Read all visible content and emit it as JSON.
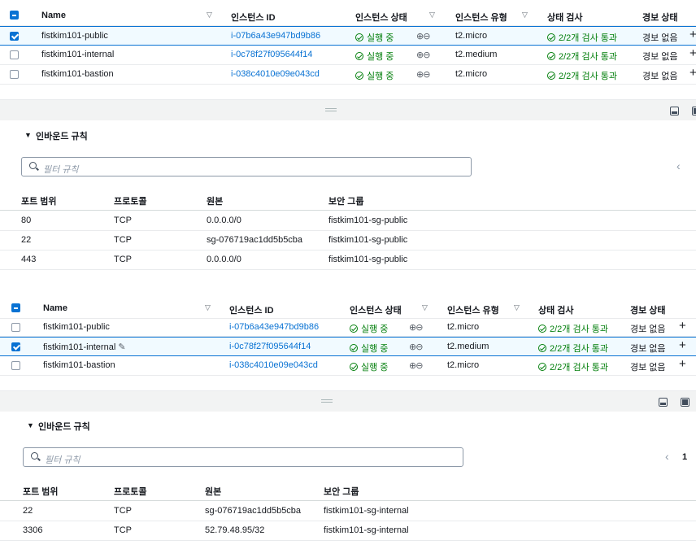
{
  "panel1": {
    "instances": {
      "headers": {
        "name": "Name",
        "id": "인스턴스 ID",
        "state": "인스턴스 상태",
        "type": "인스턴스 유형",
        "check": "상태 검사",
        "alarm": "경보 상태"
      },
      "rows": [
        {
          "name": "fistkim101-public",
          "id": "i-07b6a43e947bd9b86",
          "state": "실행 중",
          "type": "t2.micro",
          "check": "2/2개 검사 통과",
          "alarm": "경보 없음",
          "selected": true
        },
        {
          "name": "fistkim101-internal",
          "id": "i-0c78f27f095644f14",
          "state": "실행 중",
          "type": "t2.medium",
          "check": "2/2개 검사 통과",
          "alarm": "경보 없음",
          "selected": false
        },
        {
          "name": "fistkim101-bastion",
          "id": "i-038c4010e09e043cd",
          "state": "실행 중",
          "type": "t2.micro",
          "check": "2/2개 검사 통과",
          "alarm": "경보 없음",
          "selected": false
        }
      ]
    },
    "rules": {
      "title": "인바운드 규칙",
      "search_placeholder": "필터 규칙",
      "headers": {
        "port": "포트 범위",
        "proto": "프로토콜",
        "source": "원본",
        "sg": "보안 그룹"
      },
      "rows": [
        {
          "port": "80",
          "proto": "TCP",
          "source": "0.0.0.0/0",
          "sg": "fistkim101-sg-public"
        },
        {
          "port": "22",
          "proto": "TCP",
          "source": "sg-076719ac1dd5b5cba",
          "sg": "fistkim101-sg-public"
        },
        {
          "port": "443",
          "proto": "TCP",
          "source": "0.0.0.0/0",
          "sg": "fistkim101-sg-public"
        }
      ]
    }
  },
  "panel2": {
    "instances": {
      "headers": {
        "name": "Name",
        "id": "인스턴스 ID",
        "state": "인스턴스 상태",
        "type": "인스턴스 유형",
        "check": "상태 검사",
        "alarm": "경보 상태"
      },
      "rows": [
        {
          "name": "fistkim101-public",
          "id": "i-07b6a43e947bd9b86",
          "state": "실행 중",
          "type": "t2.micro",
          "check": "2/2개 검사 통과",
          "alarm": "경보 없음",
          "selected": false
        },
        {
          "name": "fistkim101-internal",
          "id": "i-0c78f27f095644f14",
          "state": "실행 중",
          "type": "t2.medium",
          "check": "2/2개 검사 통과",
          "alarm": "경보 없음",
          "selected": true
        },
        {
          "name": "fistkim101-bastion",
          "id": "i-038c4010e09e043cd",
          "state": "실행 중",
          "type": "t2.micro",
          "check": "2/2개 검사 통과",
          "alarm": "경보 없음",
          "selected": false
        }
      ]
    },
    "rules": {
      "title": "인바운드 규칙",
      "search_placeholder": "필터 규칙",
      "page_number": "1",
      "headers": {
        "port": "포트 범위",
        "proto": "프로토콜",
        "source": "원본",
        "sg": "보안 그룹"
      },
      "rows": [
        {
          "port": "22",
          "proto": "TCP",
          "source": "sg-076719ac1dd5b5cba",
          "sg": "fistkim101-sg-internal"
        },
        {
          "port": "3306",
          "proto": "TCP",
          "source": "52.79.48.95/32",
          "sg": "fistkim101-sg-internal"
        }
      ]
    }
  },
  "colors": {
    "accent": "#0972d3",
    "success": "#037f0c",
    "selected_row": "#f1faff"
  },
  "icons": [
    "checkbox-icon",
    "sort-icon",
    "zoom-icon",
    "status-ok-icon",
    "edit-icon",
    "plus-icon",
    "search-icon",
    "caret-down-icon",
    "chevron-left-icon",
    "drag-handle-icon",
    "panel-icon"
  ]
}
